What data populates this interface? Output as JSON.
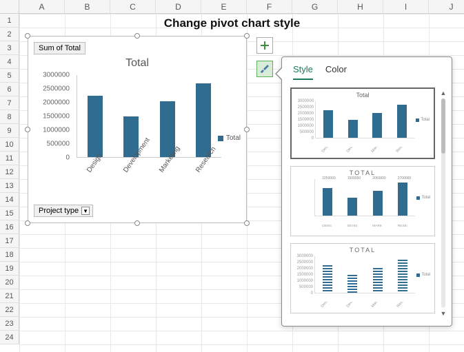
{
  "page_title": "Change pivot chart style",
  "columns": [
    "A",
    "B",
    "C",
    "D",
    "E",
    "F",
    "G",
    "H",
    "I",
    "J"
  ],
  "row_count": 24,
  "pivot_chart": {
    "sum_label": "Sum of Total",
    "project_type_label": "Project type",
    "title": "Total",
    "legend_label": "Total",
    "y_ticks": [
      "0",
      "500000",
      "1000000",
      "1500000",
      "2000000",
      "2500000",
      "3000000"
    ]
  },
  "chart_data": {
    "type": "bar",
    "title": "Total",
    "categories": [
      "Design",
      "Development",
      "Marketing",
      "Research"
    ],
    "values": [
      2250000,
      1500000,
      2050000,
      2700000
    ],
    "series_name": "Total",
    "ylim": [
      0,
      3000000
    ],
    "xlabel": "",
    "ylabel": ""
  },
  "style_panel": {
    "tab_style": "Style",
    "tab_color": "Color",
    "thumbnails": [
      {
        "title": "Total",
        "title_style": "normal",
        "bar_style": "solid",
        "show_ylabels": true,
        "xlabel_rotated": true,
        "show_data_labels": false
      },
      {
        "title": "TOTAL",
        "title_style": "spaced",
        "bar_style": "solid",
        "show_ylabels": false,
        "xlabel_rotated": false,
        "show_data_labels": true
      },
      {
        "title": "TOTAL",
        "title_style": "spaced",
        "bar_style": "striped",
        "show_ylabels": true,
        "xlabel_rotated": true,
        "show_data_labels": false
      }
    ]
  }
}
